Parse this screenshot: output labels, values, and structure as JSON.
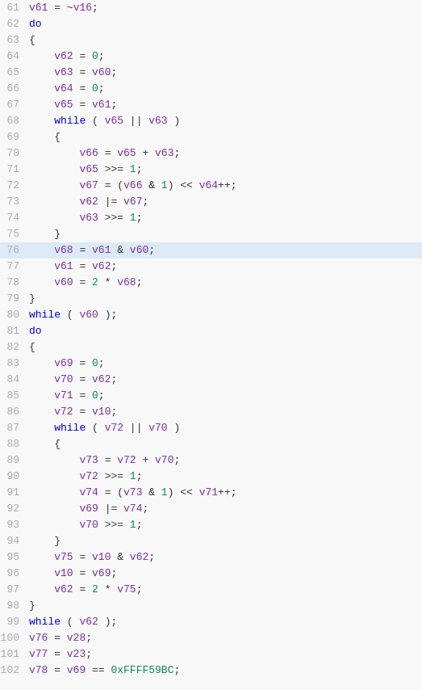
{
  "lines": [
    {
      "num": 61,
      "content": "v61 = ~v16;",
      "tokens": [
        {
          "t": "var",
          "v": "v61"
        },
        {
          "t": "plain",
          "v": " = ~"
        },
        {
          "t": "var",
          "v": "v16"
        },
        {
          "t": "plain",
          "v": ";"
        }
      ],
      "highlight": false
    },
    {
      "num": 62,
      "content": "do",
      "tokens": [
        {
          "t": "kw",
          "v": "do"
        }
      ],
      "highlight": false
    },
    {
      "num": 63,
      "content": "{",
      "tokens": [
        {
          "t": "plain",
          "v": "{"
        }
      ],
      "highlight": false
    },
    {
      "num": 64,
      "content": "    v62 = 0;",
      "tokens": [
        {
          "t": "plain",
          "v": "    "
        },
        {
          "t": "var",
          "v": "v62"
        },
        {
          "t": "plain",
          "v": " = "
        },
        {
          "t": "num",
          "v": "0"
        },
        {
          "t": "plain",
          "v": ";"
        }
      ],
      "highlight": false
    },
    {
      "num": 65,
      "content": "    v63 = v60;",
      "tokens": [
        {
          "t": "plain",
          "v": "    "
        },
        {
          "t": "var",
          "v": "v63"
        },
        {
          "t": "plain",
          "v": " = "
        },
        {
          "t": "var",
          "v": "v60"
        },
        {
          "t": "plain",
          "v": ";"
        }
      ],
      "highlight": false
    },
    {
      "num": 66,
      "content": "    v64 = 0;",
      "tokens": [
        {
          "t": "plain",
          "v": "    "
        },
        {
          "t": "var",
          "v": "v64"
        },
        {
          "t": "plain",
          "v": " = "
        },
        {
          "t": "num",
          "v": "0"
        },
        {
          "t": "plain",
          "v": ";"
        }
      ],
      "highlight": false
    },
    {
      "num": 67,
      "content": "    v65 = v61;",
      "tokens": [
        {
          "t": "plain",
          "v": "    "
        },
        {
          "t": "var",
          "v": "v65"
        },
        {
          "t": "plain",
          "v": " = "
        },
        {
          "t": "var",
          "v": "v61"
        },
        {
          "t": "plain",
          "v": ";"
        }
      ],
      "highlight": false
    },
    {
      "num": 68,
      "content": "    while ( v65 || v63 )",
      "tokens": [
        {
          "t": "plain",
          "v": "    "
        },
        {
          "t": "kw",
          "v": "while"
        },
        {
          "t": "plain",
          "v": " ( "
        },
        {
          "t": "var",
          "v": "v65"
        },
        {
          "t": "plain",
          "v": " || "
        },
        {
          "t": "var",
          "v": "v63"
        },
        {
          "t": "plain",
          "v": " )"
        }
      ],
      "highlight": false
    },
    {
      "num": 69,
      "content": "    {",
      "tokens": [
        {
          "t": "plain",
          "v": "    {"
        }
      ],
      "highlight": false
    },
    {
      "num": 70,
      "content": "        v66 = v65 + v63;",
      "tokens": [
        {
          "t": "plain",
          "v": "        "
        },
        {
          "t": "var",
          "v": "v66"
        },
        {
          "t": "plain",
          "v": " = "
        },
        {
          "t": "var",
          "v": "v65"
        },
        {
          "t": "plain",
          "v": " + "
        },
        {
          "t": "var",
          "v": "v63"
        },
        {
          "t": "plain",
          "v": ";"
        }
      ],
      "highlight": false
    },
    {
      "num": 71,
      "content": "        v65 >>= 1;",
      "tokens": [
        {
          "t": "plain",
          "v": "        "
        },
        {
          "t": "var",
          "v": "v65"
        },
        {
          "t": "plain",
          "v": " >>= "
        },
        {
          "t": "num",
          "v": "1"
        },
        {
          "t": "plain",
          "v": ";"
        }
      ],
      "highlight": false
    },
    {
      "num": 72,
      "content": "        v67 = (v66 & 1) << v64++;",
      "tokens": [
        {
          "t": "plain",
          "v": "        "
        },
        {
          "t": "var",
          "v": "v67"
        },
        {
          "t": "plain",
          "v": " = ("
        },
        {
          "t": "var",
          "v": "v66"
        },
        {
          "t": "plain",
          "v": " & "
        },
        {
          "t": "num",
          "v": "1"
        },
        {
          "t": "plain",
          "v": ") << "
        },
        {
          "t": "var",
          "v": "v64"
        },
        {
          "t": "plain",
          "v": "++;"
        }
      ],
      "highlight": false
    },
    {
      "num": 73,
      "content": "        v62 |= v67;",
      "tokens": [
        {
          "t": "plain",
          "v": "        "
        },
        {
          "t": "var",
          "v": "v62"
        },
        {
          "t": "plain",
          "v": " |= "
        },
        {
          "t": "var",
          "v": "v67"
        },
        {
          "t": "plain",
          "v": ";"
        }
      ],
      "highlight": false
    },
    {
      "num": 74,
      "content": "        v63 >>= 1;",
      "tokens": [
        {
          "t": "plain",
          "v": "        "
        },
        {
          "t": "var",
          "v": "v63"
        },
        {
          "t": "plain",
          "v": " >>= "
        },
        {
          "t": "num",
          "v": "1"
        },
        {
          "t": "plain",
          "v": ";"
        }
      ],
      "highlight": false
    },
    {
      "num": 75,
      "content": "    }",
      "tokens": [
        {
          "t": "plain",
          "v": "    }"
        }
      ],
      "highlight": false
    },
    {
      "num": 76,
      "content": "    v68 = v61 & v60;",
      "tokens": [
        {
          "t": "plain",
          "v": "    "
        },
        {
          "t": "var",
          "v": "v68"
        },
        {
          "t": "plain",
          "v": " = "
        },
        {
          "t": "var",
          "v": "v61"
        },
        {
          "t": "plain",
          "v": " & "
        },
        {
          "t": "var",
          "v": "v60"
        },
        {
          "t": "plain",
          "v": ";"
        }
      ],
      "highlight": true
    },
    {
      "num": 77,
      "content": "    v61 = v62;",
      "tokens": [
        {
          "t": "plain",
          "v": "    "
        },
        {
          "t": "var",
          "v": "v61"
        },
        {
          "t": "plain",
          "v": " = "
        },
        {
          "t": "var",
          "v": "v62"
        },
        {
          "t": "plain",
          "v": ";"
        }
      ],
      "highlight": false
    },
    {
      "num": 78,
      "content": "    v60 = 2 * v68;",
      "tokens": [
        {
          "t": "plain",
          "v": "    "
        },
        {
          "t": "var",
          "v": "v60"
        },
        {
          "t": "plain",
          "v": " = "
        },
        {
          "t": "num",
          "v": "2"
        },
        {
          "t": "plain",
          "v": " * "
        },
        {
          "t": "var",
          "v": "v68"
        },
        {
          "t": "plain",
          "v": ";"
        }
      ],
      "highlight": false
    },
    {
      "num": 79,
      "content": "}",
      "tokens": [
        {
          "t": "plain",
          "v": "}"
        }
      ],
      "highlight": false
    },
    {
      "num": 80,
      "content": "while ( v60 );",
      "tokens": [
        {
          "t": "kw",
          "v": "while"
        },
        {
          "t": "plain",
          "v": " ( "
        },
        {
          "t": "var",
          "v": "v60"
        },
        {
          "t": "plain",
          "v": " );"
        }
      ],
      "highlight": false
    },
    {
      "num": 81,
      "content": "do",
      "tokens": [
        {
          "t": "kw",
          "v": "do"
        }
      ],
      "highlight": false
    },
    {
      "num": 82,
      "content": "{",
      "tokens": [
        {
          "t": "plain",
          "v": "{"
        }
      ],
      "highlight": false
    },
    {
      "num": 83,
      "content": "    v69 = 0;",
      "tokens": [
        {
          "t": "plain",
          "v": "    "
        },
        {
          "t": "var",
          "v": "v69"
        },
        {
          "t": "plain",
          "v": " = "
        },
        {
          "t": "num",
          "v": "0"
        },
        {
          "t": "plain",
          "v": ";"
        }
      ],
      "highlight": false
    },
    {
      "num": 84,
      "content": "    v70 = v62;",
      "tokens": [
        {
          "t": "plain",
          "v": "    "
        },
        {
          "t": "var",
          "v": "v70"
        },
        {
          "t": "plain",
          "v": " = "
        },
        {
          "t": "var",
          "v": "v62"
        },
        {
          "t": "plain",
          "v": ";"
        }
      ],
      "highlight": false
    },
    {
      "num": 85,
      "content": "    v71 = 0;",
      "tokens": [
        {
          "t": "plain",
          "v": "    "
        },
        {
          "t": "var",
          "v": "v71"
        },
        {
          "t": "plain",
          "v": " = "
        },
        {
          "t": "num",
          "v": "0"
        },
        {
          "t": "plain",
          "v": ";"
        }
      ],
      "highlight": false
    },
    {
      "num": 86,
      "content": "    v72 = v10;",
      "tokens": [
        {
          "t": "plain",
          "v": "    "
        },
        {
          "t": "var",
          "v": "v72"
        },
        {
          "t": "plain",
          "v": " = "
        },
        {
          "t": "var",
          "v": "v10"
        },
        {
          "t": "plain",
          "v": ";"
        }
      ],
      "highlight": false
    },
    {
      "num": 87,
      "content": "    while ( v72 || v70 )",
      "tokens": [
        {
          "t": "plain",
          "v": "    "
        },
        {
          "t": "kw",
          "v": "while"
        },
        {
          "t": "plain",
          "v": " ( "
        },
        {
          "t": "var",
          "v": "v72"
        },
        {
          "t": "plain",
          "v": " || "
        },
        {
          "t": "var",
          "v": "v70"
        },
        {
          "t": "plain",
          "v": " )"
        }
      ],
      "highlight": false
    },
    {
      "num": 88,
      "content": "    {",
      "tokens": [
        {
          "t": "plain",
          "v": "    {"
        }
      ],
      "highlight": false
    },
    {
      "num": 89,
      "content": "        v73 = v72 + v70;",
      "tokens": [
        {
          "t": "plain",
          "v": "        "
        },
        {
          "t": "var",
          "v": "v73"
        },
        {
          "t": "plain",
          "v": " = "
        },
        {
          "t": "var",
          "v": "v72"
        },
        {
          "t": "plain",
          "v": " + "
        },
        {
          "t": "var",
          "v": "v70"
        },
        {
          "t": "plain",
          "v": ";"
        }
      ],
      "highlight": false
    },
    {
      "num": 90,
      "content": "        v72 >>= 1;",
      "tokens": [
        {
          "t": "plain",
          "v": "        "
        },
        {
          "t": "var",
          "v": "v72"
        },
        {
          "t": "plain",
          "v": " >>= "
        },
        {
          "t": "num",
          "v": "1"
        },
        {
          "t": "plain",
          "v": ";"
        }
      ],
      "highlight": false
    },
    {
      "num": 91,
      "content": "        v74 = (v73 & 1) << v71++;",
      "tokens": [
        {
          "t": "plain",
          "v": "        "
        },
        {
          "t": "var",
          "v": "v74"
        },
        {
          "t": "plain",
          "v": " = ("
        },
        {
          "t": "var",
          "v": "v73"
        },
        {
          "t": "plain",
          "v": " & "
        },
        {
          "t": "num",
          "v": "1"
        },
        {
          "t": "plain",
          "v": ") << "
        },
        {
          "t": "var",
          "v": "v71"
        },
        {
          "t": "plain",
          "v": "++;"
        }
      ],
      "highlight": false
    },
    {
      "num": 92,
      "content": "        v69 |= v74;",
      "tokens": [
        {
          "t": "plain",
          "v": "        "
        },
        {
          "t": "var",
          "v": "v69"
        },
        {
          "t": "plain",
          "v": " |= "
        },
        {
          "t": "var",
          "v": "v74"
        },
        {
          "t": "plain",
          "v": ";"
        }
      ],
      "highlight": false
    },
    {
      "num": 93,
      "content": "        v70 >>= 1;",
      "tokens": [
        {
          "t": "plain",
          "v": "        "
        },
        {
          "t": "var",
          "v": "v70"
        },
        {
          "t": "plain",
          "v": " >>= "
        },
        {
          "t": "num",
          "v": "1"
        },
        {
          "t": "plain",
          "v": ";"
        }
      ],
      "highlight": false
    },
    {
      "num": 94,
      "content": "    }",
      "tokens": [
        {
          "t": "plain",
          "v": "    }"
        }
      ],
      "highlight": false
    },
    {
      "num": 95,
      "content": "    v75 = v10 & v62;",
      "tokens": [
        {
          "t": "plain",
          "v": "    "
        },
        {
          "t": "var",
          "v": "v75"
        },
        {
          "t": "plain",
          "v": " = "
        },
        {
          "t": "var",
          "v": "v10"
        },
        {
          "t": "plain",
          "v": " & "
        },
        {
          "t": "var",
          "v": "v62"
        },
        {
          "t": "plain",
          "v": ";"
        }
      ],
      "highlight": false
    },
    {
      "num": 96,
      "content": "    v10 = v69;",
      "tokens": [
        {
          "t": "plain",
          "v": "    "
        },
        {
          "t": "var",
          "v": "v10"
        },
        {
          "t": "plain",
          "v": " = "
        },
        {
          "t": "var",
          "v": "v69"
        },
        {
          "t": "plain",
          "v": ";"
        }
      ],
      "highlight": false
    },
    {
      "num": 97,
      "content": "    v62 = 2 * v75;",
      "tokens": [
        {
          "t": "plain",
          "v": "    "
        },
        {
          "t": "var",
          "v": "v62"
        },
        {
          "t": "plain",
          "v": " = "
        },
        {
          "t": "num",
          "v": "2"
        },
        {
          "t": "plain",
          "v": " * "
        },
        {
          "t": "var",
          "v": "v75"
        },
        {
          "t": "plain",
          "v": ";"
        }
      ],
      "highlight": false
    },
    {
      "num": 98,
      "content": "}",
      "tokens": [
        {
          "t": "plain",
          "v": "}"
        }
      ],
      "highlight": false
    },
    {
      "num": 99,
      "content": "while ( v62 );",
      "tokens": [
        {
          "t": "kw",
          "v": "while"
        },
        {
          "t": "plain",
          "v": " ( "
        },
        {
          "t": "var",
          "v": "v62"
        },
        {
          "t": "plain",
          "v": " );"
        }
      ],
      "highlight": false
    },
    {
      "num": 100,
      "content": "v76 = v28;",
      "tokens": [
        {
          "t": "var",
          "v": "v76"
        },
        {
          "t": "plain",
          "v": " = "
        },
        {
          "t": "var",
          "v": "v28"
        },
        {
          "t": "plain",
          "v": ";"
        }
      ],
      "highlight": false
    },
    {
      "num": 101,
      "content": "v77 = v23;",
      "tokens": [
        {
          "t": "var",
          "v": "v77"
        },
        {
          "t": "plain",
          "v": " = "
        },
        {
          "t": "var",
          "v": "v23"
        },
        {
          "t": "plain",
          "v": ";"
        }
      ],
      "highlight": false
    },
    {
      "num": 102,
      "content": "v78 = v69 == 0xFFFF59BC;",
      "tokens": [
        {
          "t": "var",
          "v": "v78"
        },
        {
          "t": "plain",
          "v": " = "
        },
        {
          "t": "var",
          "v": "v69"
        },
        {
          "t": "plain",
          "v": " == "
        },
        {
          "t": "hex",
          "v": "0xFFFF59BC"
        },
        {
          "t": "plain",
          "v": ";"
        }
      ],
      "highlight": false
    }
  ]
}
